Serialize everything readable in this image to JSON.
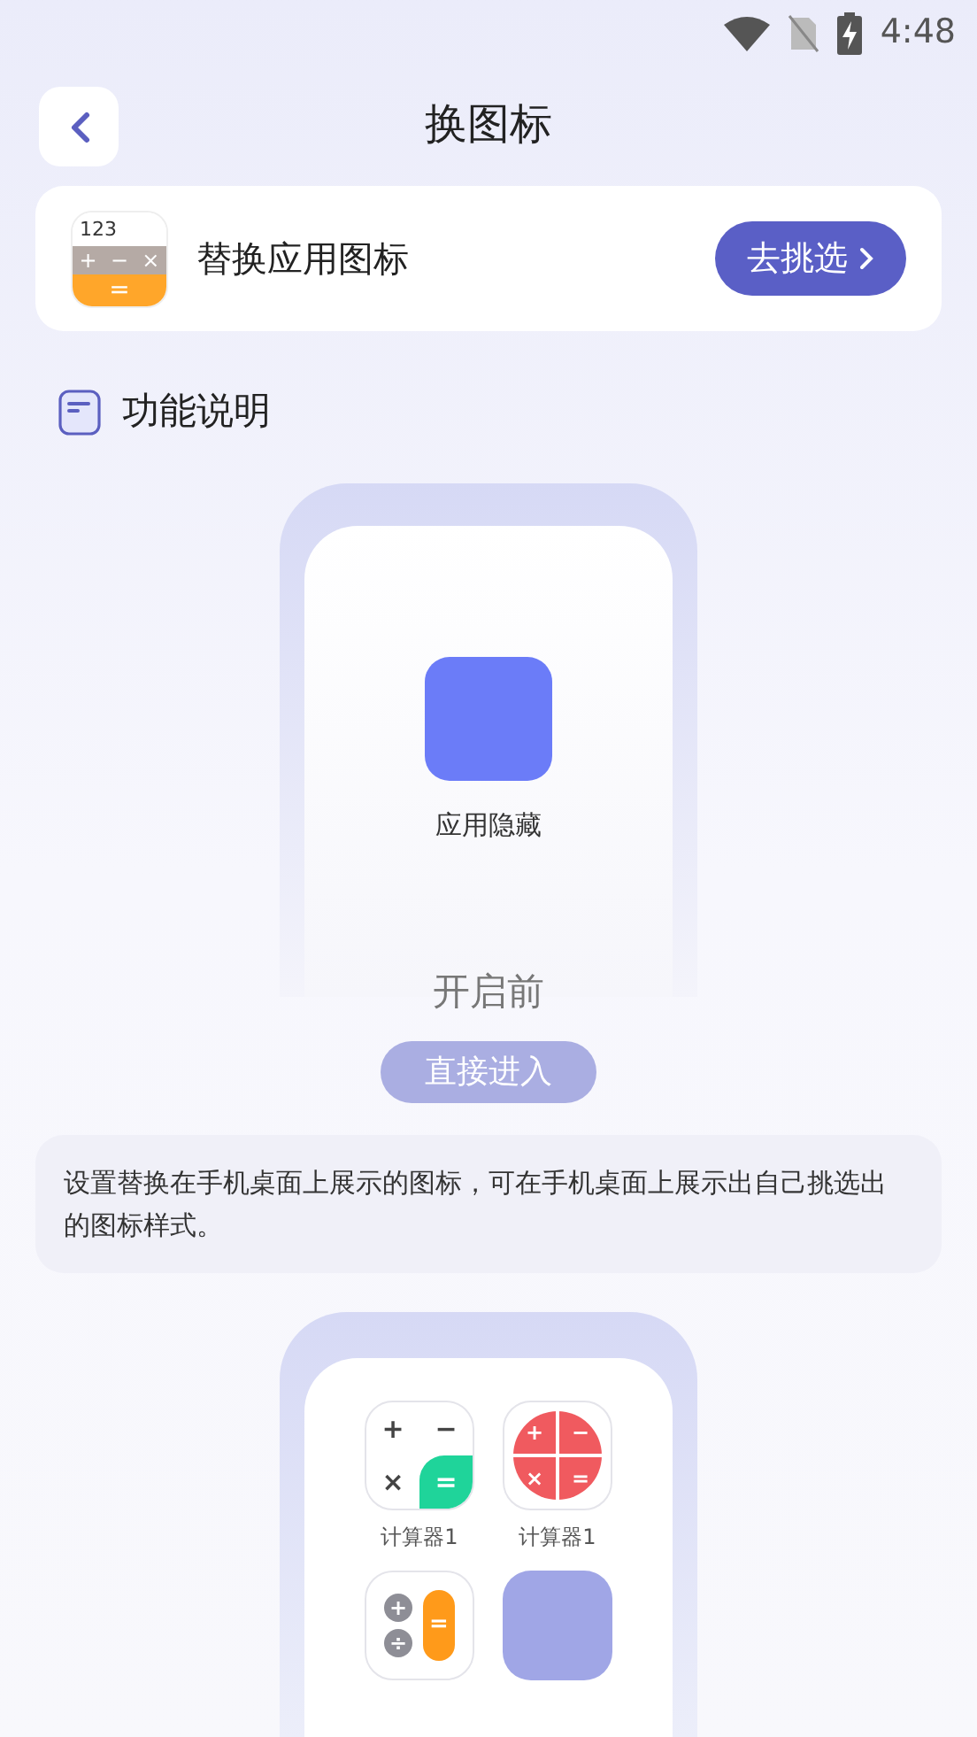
{
  "status_bar": {
    "time": "4:48"
  },
  "header": {
    "title": "换图标"
  },
  "app_card": {
    "icon": {
      "display": "123",
      "keys": [
        "+",
        "−",
        "×"
      ],
      "equals": "="
    },
    "title": "替换应用图标",
    "button": "去挑选"
  },
  "section": {
    "title": "功能说明"
  },
  "demo": {
    "app": {
      "name": "应用隐藏"
    },
    "caption": "开启前",
    "button": "直接进入"
  },
  "description": "设置替换在手机桌面上展示的图标，可在手机桌面上展示出自己挑选出的图标样式。",
  "icon_grid": [
    {
      "kind": "green",
      "keys": [
        "+",
        "−",
        "×",
        "="
      ],
      "label": "计算器1"
    },
    {
      "kind": "red",
      "keys": [
        "+",
        "−",
        "×",
        "="
      ],
      "label": "计算器1"
    },
    {
      "kind": "orange",
      "keys": [
        "+",
        "÷",
        "="
      ]
    },
    {
      "kind": "purple"
    }
  ]
}
